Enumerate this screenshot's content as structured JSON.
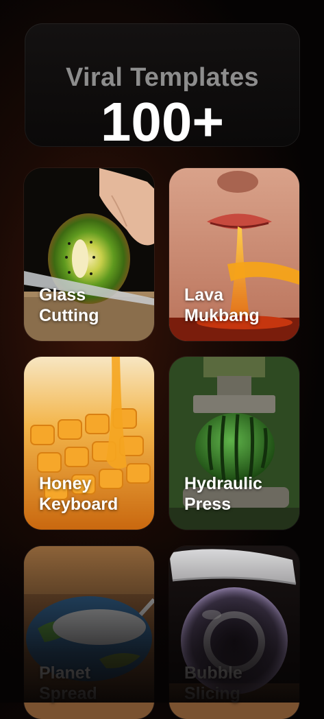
{
  "header": {
    "subtitle": "Viral Templates",
    "count": "100+"
  },
  "templates": [
    {
      "line1": "Glass",
      "line2": "Cutting"
    },
    {
      "line1": "Lava",
      "line2": "Mukbang"
    },
    {
      "line1": "Honey",
      "line2": "Keyboard"
    },
    {
      "line1": "Hydraulic",
      "line2": "Press"
    },
    {
      "line1": "Planet",
      "line2": "Spread"
    },
    {
      "line1": "Bubble",
      "line2": "Slicing"
    }
  ]
}
